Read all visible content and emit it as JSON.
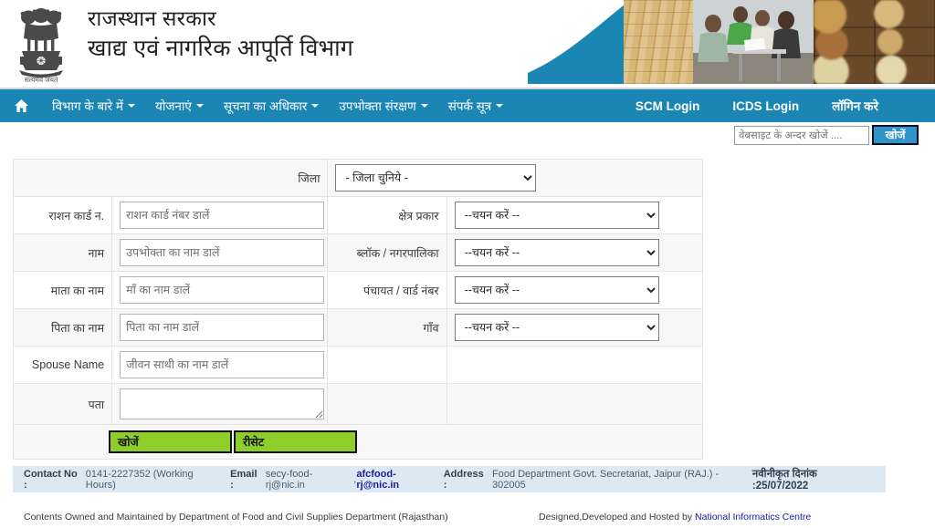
{
  "header": {
    "emblem_icon": "india-state-emblem",
    "emblem_motto": "सत्यमेव जयते",
    "title_line1": "राजस्थान सरकार",
    "title_line2": "खाद्य एवं नागरिक आपूर्ति विभाग",
    "banner_alt": "ration-distribution-banner"
  },
  "nav": {
    "home_icon": "home-icon",
    "items": [
      {
        "label": "विभाग के बारे में",
        "has_caret": true
      },
      {
        "label": "योजनाएं",
        "has_caret": true
      },
      {
        "label": "सूचना का अधिकार",
        "has_caret": true
      },
      {
        "label": "उपभोक्ता संरक्षण",
        "has_caret": true
      },
      {
        "label": "संपर्क सूत्र",
        "has_caret": true
      }
    ],
    "right_items": [
      {
        "label": "SCM Login"
      },
      {
        "label": "ICDS Login"
      },
      {
        "label": "लॉगिन करे"
      }
    ],
    "bg_color": "#1b86b4"
  },
  "site_search": {
    "placeholder": "वेबसाइट के अन्दर खोजें ....",
    "value": "",
    "button_label": "खोजें",
    "button_color": "#2f95c8"
  },
  "form": {
    "district": {
      "label": "जिला",
      "selected": "- जिला चुनिये -"
    },
    "rows": [
      {
        "left_label": "राशन कार्ड न.",
        "input_placeholder": "राशन कार्ड नंबर डालें",
        "input_value": "",
        "input_type": "text",
        "right_label": "क्षेत्र प्रकार",
        "right_selected": "--चयन करें --"
      },
      {
        "left_label": "नाम",
        "input_placeholder": "उपभोक्ता का नाम डालें",
        "input_value": "",
        "input_type": "text",
        "right_label": "ब्लॉक / नगरपालिका",
        "right_selected": "--चयन करें --"
      },
      {
        "left_label": "माता का नाम",
        "input_placeholder": "माँ का नाम डालें",
        "input_value": "",
        "input_type": "text",
        "right_label": "पंचायत / वार्ड नंबर",
        "right_selected": "--चयन करें --"
      },
      {
        "left_label": "पिता का नाम",
        "input_placeholder": "पिता का नाम डालें",
        "input_value": "",
        "input_type": "text",
        "right_label": "गाँव",
        "right_selected": "--चयन करें --"
      },
      {
        "left_label": "Spouse Name",
        "input_placeholder": "जीवन साथी का नाम डालें",
        "input_value": "",
        "input_type": "text",
        "right_label": "",
        "right_selected": ""
      },
      {
        "left_label": "पता",
        "input_placeholder": "",
        "input_value": "",
        "input_type": "textarea",
        "right_label": "",
        "right_selected": ""
      }
    ],
    "search_button": "खोजें",
    "reset_button": "रीसेट",
    "button_color": "#8dce2b"
  },
  "footer": {
    "contact_label": "Contact No :",
    "contact_value": "0141-2227352 (Working Hours)",
    "email_label": "Email :",
    "email_plain": "secy-food-rj@nic.in",
    "email_link": "afcfood-rj@nic.in",
    "address_label": "Address :",
    "address_value": "Food Department Govt. Secretariat, Jaipur (RAJ.) - 302005",
    "updated_text": "नवीनीकृत दिनांक :25/07/2022",
    "bg_color": "#dce9f2",
    "owned_text": "Contents Owned and Maintained by Department of Food and Civil Supplies Department (Rajasthan)",
    "designed_text": "Designed,Developed and Hosted by",
    "nic_link": "National Informatics Centre"
  }
}
